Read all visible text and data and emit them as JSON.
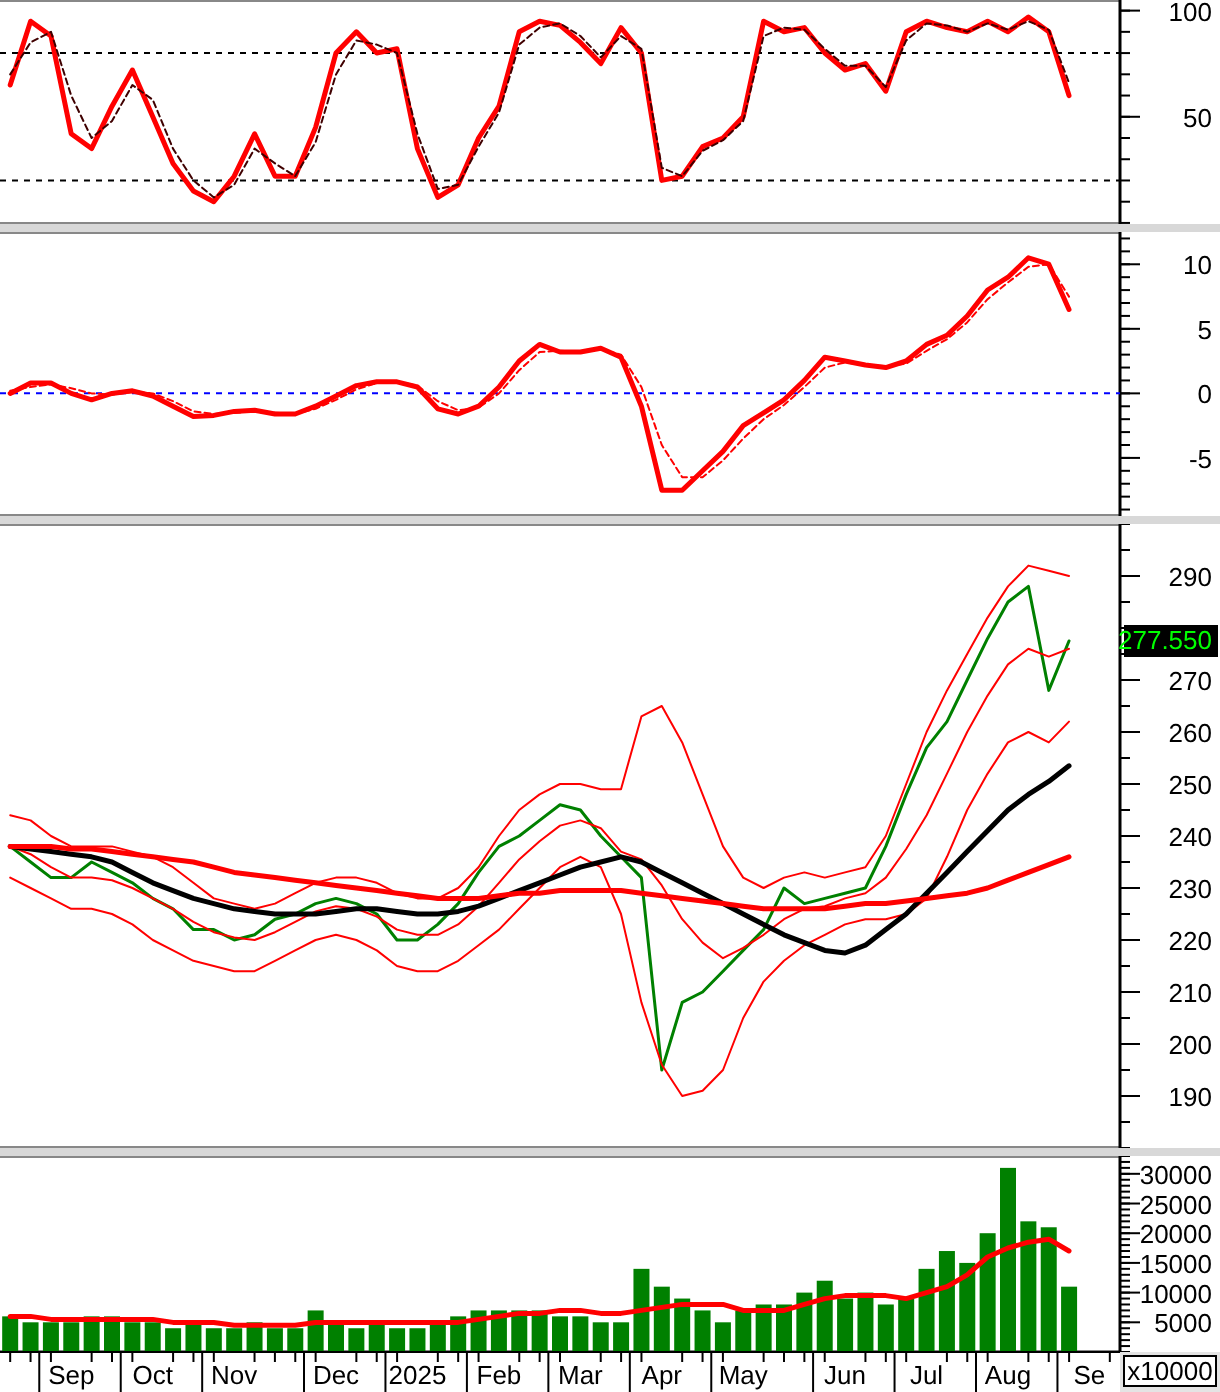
{
  "stochastic_panel": {
    "chart_data": {
      "type": "line",
      "categories": [
        null,
        null,
        null,
        null,
        null,
        null,
        null,
        null,
        null,
        null,
        null,
        null,
        null,
        null,
        null,
        null,
        null,
        null,
        null,
        null,
        null,
        null,
        null,
        null,
        null,
        null,
        null,
        null,
        null,
        null,
        null,
        null,
        null,
        null,
        null,
        null,
        null,
        null,
        null,
        null,
        null,
        null,
        null,
        null,
        null,
        null,
        null,
        null,
        null,
        null,
        null,
        null,
        null,
        null,
        null
      ],
      "ylim": [
        -0.5,
        105
      ],
      "yticks": [
        50,
        100
      ],
      "series": [
        {
          "color": "#ff0000",
          "line_style": "solid",
          "values": [
            65,
            95,
            88,
            42,
            35,
            55,
            72,
            50,
            28,
            15,
            10,
            22,
            42,
            22,
            22,
            45,
            80,
            90,
            80,
            82,
            35,
            12,
            18,
            40,
            55,
            90,
            95,
            93,
            85,
            75,
            92,
            80,
            20,
            22,
            36,
            40,
            50,
            95,
            90,
            92,
            80,
            72,
            75,
            62,
            90,
            95,
            92,
            90,
            95,
            90,
            97,
            90,
            60,
            null,
            null
          ]
        },
        {
          "color": "#400000",
          "line_style": "dashed",
          "values": [
            70,
            85,
            90,
            60,
            40,
            48,
            65,
            58,
            35,
            20,
            12,
            18,
            35,
            28,
            22,
            38,
            70,
            86,
            84,
            80,
            42,
            16,
            18,
            36,
            52,
            84,
            92,
            94,
            88,
            78,
            88,
            82,
            26,
            22,
            34,
            39,
            48,
            88,
            92,
            91,
            82,
            74,
            74,
            64,
            86,
            94,
            93,
            90,
            94,
            91,
            95,
            91,
            66,
            null,
            null
          ]
        }
      ],
      "ref_lines": [
        {
          "axis": "y",
          "value": 80,
          "color": "#000000",
          "line_style": "dashed"
        },
        {
          "axis": "y",
          "value": 20,
          "color": "#000000",
          "line_style": "dashed"
        }
      ]
    }
  },
  "macd_panel": {
    "chart_data": {
      "type": "line",
      "categories": [
        null,
        null,
        null,
        null,
        null,
        null,
        null,
        null,
        null,
        null,
        null,
        null,
        null,
        null,
        null,
        null,
        null,
        null,
        null,
        null,
        null,
        null,
        null,
        null,
        null,
        null,
        null,
        null,
        null,
        null,
        null,
        null,
        null,
        null,
        null,
        null,
        null,
        null,
        null,
        null,
        null,
        null,
        null,
        null,
        null,
        null,
        null,
        null,
        null,
        null,
        null,
        null,
        null,
        null,
        null
      ],
      "ylim": [
        -9.5,
        12.5
      ],
      "yticks": [
        -5,
        0,
        5,
        10
      ],
      "series": [
        {
          "color": "#ff0000",
          "line_style": "solid",
          "values": [
            0,
            0.8,
            0.8,
            0,
            -0.5,
            0,
            0.2,
            -0.2,
            -1,
            -1.8,
            -1.7,
            -1.4,
            -1.3,
            -1.6,
            -1.6,
            -1,
            -0.2,
            0.6,
            0.9,
            0.9,
            0.5,
            -1.2,
            -1.6,
            -1,
            0.5,
            2.5,
            3.8,
            3.2,
            3.2,
            3.5,
            2.8,
            -1,
            -7.5,
            -7.5,
            -6,
            -4.5,
            -2.5,
            -1.5,
            -0.5,
            1,
            2.8,
            2.5,
            2.2,
            2,
            2.5,
            3.8,
            4.5,
            6,
            8,
            9,
            10.5,
            10,
            6.5,
            null,
            null
          ]
        },
        {
          "color": "#ff0000",
          "line_style": "dashed",
          "values": [
            0.2,
            0.5,
            0.7,
            0.4,
            0,
            -0.1,
            0.1,
            0,
            -0.6,
            -1.4,
            -1.6,
            -1.5,
            -1.4,
            -1.5,
            -1.6,
            -1.2,
            -0.5,
            0.3,
            0.8,
            0.9,
            0.6,
            -0.6,
            -1.3,
            -1.1,
            0,
            1.8,
            3.2,
            3.3,
            3.2,
            3.4,
            3,
            0.5,
            -4,
            -6.5,
            -6.5,
            -5.2,
            -3.5,
            -2,
            -0.9,
            0.5,
            2,
            2.4,
            2.2,
            2.1,
            2.3,
            3.3,
            4.2,
            5.5,
            7.3,
            8.6,
            9.8,
            10,
            7.5,
            null,
            null
          ]
        }
      ],
      "ref_lines": [
        {
          "axis": "y",
          "value": 0,
          "color": "#0000ff",
          "line_style": "dashed"
        }
      ]
    }
  },
  "price_panel": {
    "chart_data": {
      "type": "line",
      "categories": [
        null,
        null,
        null,
        null,
        null,
        null,
        null,
        null,
        null,
        null,
        null,
        null,
        null,
        null,
        null,
        null,
        null,
        null,
        null,
        null,
        null,
        null,
        null,
        null,
        null,
        null,
        null,
        null,
        null,
        null,
        null,
        null,
        null,
        null,
        null,
        null,
        null,
        null,
        null,
        null,
        null,
        null,
        null,
        null,
        null,
        null,
        null,
        null,
        null,
        null,
        null,
        null,
        null,
        null,
        null
      ],
      "ylim": [
        180,
        300
      ],
      "yticks": [
        190,
        200,
        210,
        220,
        230,
        240,
        250,
        260,
        270,
        290
      ],
      "series": [
        {
          "color": "#008000",
          "line_style": "solid",
          "values": [
            238,
            235,
            232,
            232,
            235,
            233,
            231,
            228,
            226,
            222,
            222,
            220,
            221,
            224,
            225,
            227,
            228,
            227,
            225,
            220,
            220,
            223,
            227,
            233,
            238,
            240,
            243,
            246,
            245,
            240,
            236,
            232,
            195,
            208,
            210,
            214,
            218,
            222,
            230,
            227,
            228,
            229,
            230,
            238,
            248,
            257,
            262,
            270,
            278,
            285,
            288,
            268,
            277.5,
            null,
            null
          ]
        },
        {
          "color": "#ff0000",
          "line_style": "solid",
          "values": [
            244,
            243,
            240,
            238,
            238,
            238,
            237,
            236,
            234,
            231,
            228,
            227,
            226,
            227,
            229,
            231,
            232,
            232,
            231,
            229,
            228,
            228,
            230,
            234,
            240,
            245,
            248,
            250,
            250,
            249,
            249,
            263,
            265,
            258,
            248,
            238,
            232,
            230,
            232,
            233,
            232,
            233,
            234,
            240,
            250,
            260,
            268,
            275,
            282,
            288,
            292,
            291,
            290,
            null,
            null
          ]
        },
        {
          "color": "#ff0000",
          "line_style": "solid",
          "values": [
            238,
            236.5,
            234,
            232,
            232,
            231.5,
            230,
            228,
            226,
            223.5,
            221.5,
            220.5,
            220,
            221.5,
            223.5,
            225.5,
            226.5,
            226,
            224.5,
            222,
            221,
            221,
            223,
            226.5,
            231,
            235.5,
            239,
            242,
            243,
            241.5,
            237,
            235.5,
            230.5,
            224,
            219.5,
            216.5,
            218.5,
            221,
            224,
            226,
            226.5,
            228,
            229,
            232,
            237.5,
            244,
            252,
            260,
            267,
            273,
            276,
            274.5,
            276,
            null,
            null
          ]
        },
        {
          "color": "#ff0000",
          "line_style": "solid",
          "values": [
            232,
            230,
            228,
            226,
            226,
            225,
            223,
            220,
            218,
            216,
            215,
            214,
            214,
            216,
            218,
            220,
            221,
            220,
            218,
            215,
            214,
            214,
            216,
            219,
            222,
            226,
            230,
            234,
            236,
            234,
            225,
            208,
            196,
            190,
            191,
            195,
            205,
            212,
            216,
            219,
            221,
            223,
            224,
            224,
            225,
            228,
            236,
            245,
            252,
            258,
            260,
            258,
            262,
            null,
            null
          ]
        },
        {
          "color": "#000000",
          "line_style": "solid",
          "values": [
            238,
            237.5,
            237,
            236.5,
            236,
            235,
            233,
            231,
            229.5,
            228,
            227,
            226,
            225.5,
            225,
            225,
            225,
            225.5,
            226,
            226,
            225.5,
            225,
            225,
            225.5,
            226.5,
            228,
            229.5,
            231,
            232.5,
            234,
            235,
            236,
            235,
            233,
            231,
            229,
            227,
            225,
            223,
            221,
            219.5,
            218,
            217.5,
            219,
            222,
            225,
            229,
            233,
            237,
            241,
            245,
            248,
            250.5,
            253.5,
            null,
            null
          ]
        },
        {
          "color": "#ff0000",
          "line_style": "solid",
          "values": [
            238,
            238,
            238,
            237.5,
            237.5,
            237,
            236.5,
            236,
            235.5,
            235,
            234,
            233,
            232.5,
            232,
            231.5,
            231,
            230.5,
            230,
            229.5,
            229,
            228.5,
            228,
            228,
            228,
            228.5,
            229,
            229,
            229.5,
            229.5,
            229.5,
            229.5,
            229,
            228.5,
            228,
            227.5,
            227,
            226.5,
            226,
            226,
            226,
            226,
            226.5,
            227,
            227,
            227.5,
            228,
            228.5,
            229,
            230,
            231.5,
            233,
            234.5,
            236,
            null,
            null
          ]
        }
      ],
      "annotations": [
        "277.550"
      ]
    }
  },
  "volume_panel": {
    "chart_data": {
      "type": "bar",
      "categories": [
        null,
        null,
        null,
        "Sep",
        null,
        null,
        null,
        "Oct",
        null,
        null,
        null,
        "Nov",
        null,
        null,
        null,
        null,
        "Dec",
        null,
        null,
        null,
        "2025",
        null,
        null,
        null,
        "Feb",
        null,
        null,
        null,
        "Mar",
        null,
        null,
        null,
        "Apr",
        null,
        null,
        null,
        "May",
        null,
        null,
        null,
        null,
        "Jun",
        null,
        null,
        null,
        "Jul",
        null,
        null,
        null,
        "Aug",
        null,
        null,
        null,
        "Se",
        null
      ],
      "ylim": [
        0,
        33000
      ],
      "ylabel": "x10000",
      "yticks": [
        5000,
        10000,
        15000,
        20000,
        25000,
        30000
      ],
      "series": [
        {
          "color": "#008000",
          "values": [
            6000,
            5000,
            5000,
            5000,
            6000,
            6000,
            5000,
            5000,
            4000,
            5000,
            4000,
            4000,
            5000,
            4000,
            4000,
            7000,
            5000,
            4000,
            5000,
            4000,
            4000,
            5000,
            6000,
            7000,
            7000,
            7000,
            7000,
            6000,
            6000,
            5000,
            5000,
            14000,
            11000,
            9000,
            7000,
            5000,
            7000,
            8000,
            8000,
            10000,
            12000,
            9000,
            10000,
            8000,
            9000,
            14000,
            17000,
            15000,
            20000,
            31000,
            22000,
            21000,
            11000,
            null,
            null
          ]
        },
        {
          "type": "line",
          "color": "#ff0000",
          "line_style": "solid",
          "values": [
            6000,
            6000,
            5500,
            5500,
            5500,
            5500,
            5500,
            5500,
            5000,
            5000,
            5000,
            4500,
            4500,
            4500,
            4500,
            5000,
            5000,
            5000,
            5000,
            5000,
            5000,
            5000,
            5000,
            5500,
            6000,
            6500,
            6500,
            7000,
            7000,
            6500,
            6500,
            7000,
            7500,
            8000,
            8000,
            8000,
            7000,
            7000,
            7000,
            8000,
            9000,
            9500,
            9500,
            9500,
            9000,
            10000,
            11000,
            13000,
            16000,
            17500,
            18500,
            19000,
            17000,
            null,
            null
          ]
        }
      ]
    }
  }
}
